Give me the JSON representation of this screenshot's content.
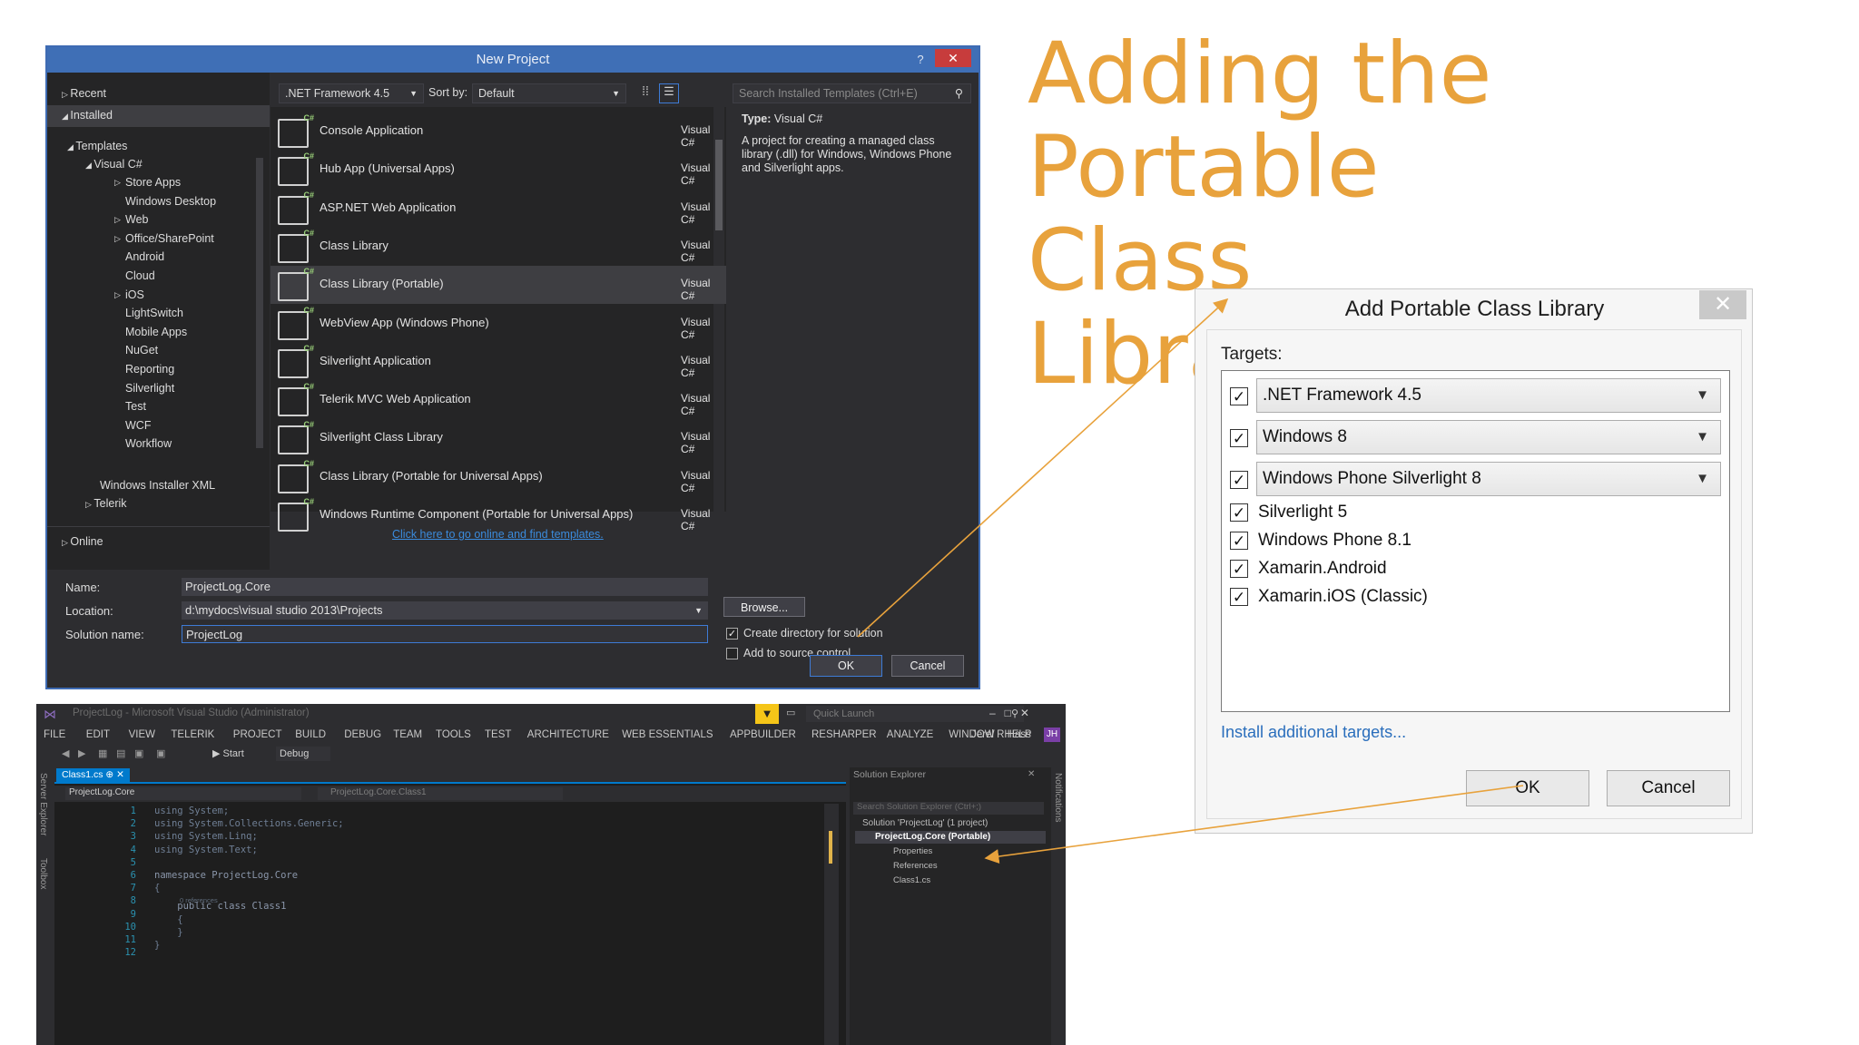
{
  "slide": {
    "title_lines": [
      "Adding the",
      "Portable Class",
      "Library"
    ]
  },
  "new_project": {
    "title": "New Project",
    "help": "?",
    "close": "✕",
    "tree": {
      "recent": "Recent",
      "installed": "Installed",
      "templates": "Templates",
      "visual_csharp": "Visual C#",
      "children": [
        "Store Apps",
        "Windows Desktop",
        "Web",
        "Office/SharePoint",
        "Android",
        "Cloud",
        "iOS",
        "LightSwitch",
        "Mobile Apps",
        "NuGet",
        "Reporting",
        "Silverlight",
        "Test",
        "WCF",
        "Workflow"
      ],
      "windows_installer_xml": "Windows Installer XML",
      "telerik": "Telerik",
      "online": "Online"
    },
    "framework": ".NET Framework 4.5",
    "sort_by_label": "Sort by:",
    "sort_by_value": "Default",
    "search_placeholder": "Search Installed Templates (Ctrl+E)",
    "templates": [
      {
        "name": "Console Application",
        "lang": "Visual C#"
      },
      {
        "name": "Hub App (Universal Apps)",
        "lang": "Visual C#"
      },
      {
        "name": "ASP.NET Web Application",
        "lang": "Visual C#"
      },
      {
        "name": "Class Library",
        "lang": "Visual C#"
      },
      {
        "name": "Class Library (Portable)",
        "lang": "Visual C#"
      },
      {
        "name": "WebView App (Windows Phone)",
        "lang": "Visual C#"
      },
      {
        "name": "Silverlight Application",
        "lang": "Visual C#"
      },
      {
        "name": "Telerik MVC Web Application",
        "lang": "Visual C#"
      },
      {
        "name": "Silverlight Class Library",
        "lang": "Visual C#"
      },
      {
        "name": "Class Library (Portable for Universal Apps)",
        "lang": "Visual C#"
      },
      {
        "name": "Windows Runtime Component (Portable for Universal Apps)",
        "lang": "Visual C#"
      }
    ],
    "online_link": "Click here to go online and find templates.",
    "description": {
      "type_label": "Type:",
      "type_value": "Visual C#",
      "text": "A project for creating a managed class library (.dll) for Windows, Windows Phone and Silverlight apps."
    },
    "name_label": "Name:",
    "name_value": "ProjectLog.Core",
    "location_label": "Location:",
    "location_value": "d:\\mydocs\\visual studio 2013\\Projects",
    "solution_label": "Solution name:",
    "solution_value": "ProjectLog",
    "browse": "Browse...",
    "create_dir": "Create directory for solution",
    "add_source": "Add to source control",
    "ok": "OK",
    "cancel": "Cancel"
  },
  "ide": {
    "title": "ProjectLog - Microsoft Visual Studio (Administrator)",
    "quick_launch": "Quick Launch",
    "menus": [
      "FILE",
      "EDIT",
      "VIEW",
      "TELERIK",
      "PROJECT",
      "BUILD",
      "DEBUG",
      "TEAM",
      "TOOLS",
      "TEST",
      "ARCHITECTURE",
      "WEB ESSENTIALS",
      "APPBUILDER",
      "RESHARPER",
      "ANALYZE",
      "WINDOW",
      "HELP"
    ],
    "user": "Jerel R Hass",
    "user_initials": "JH",
    "start": "Start",
    "config": "Debug",
    "side_tabs": [
      "Server Explorer",
      "Toolbox"
    ],
    "right_tab": "Notifications",
    "doc_tab": "Class1.cs",
    "nav_left": "ProjectLog.Core",
    "nav_right": "ProjectLog.Core.Class1",
    "line_numbers": [
      "1",
      "2",
      "3",
      "4",
      "5",
      "6",
      "7",
      "8",
      "9",
      "10",
      "11",
      "12"
    ],
    "code_lines": [
      "using System;",
      "using System.Collections.Generic;",
      "using System.Linq;",
      "using System.Text;",
      "",
      "namespace ProjectLog.Core",
      "{",
      "    public class Class1",
      "    {",
      "    }",
      "}",
      ""
    ],
    "code_lens": "0 references",
    "solution_explorer": {
      "title": "Solution Explorer",
      "search": "Search Solution Explorer (Ctrl+;)",
      "items": [
        "Solution 'ProjectLog' (1 project)",
        "ProjectLog.Core (Portable)",
        "Properties",
        "References",
        "Class1.cs"
      ]
    }
  },
  "add_pcl": {
    "title": "Add Portable Class Library",
    "close": "✕",
    "targets_label": "Targets:",
    "combo_targets": [
      ".NET Framework 4.5",
      "Windows 8",
      "Windows Phone Silverlight 8"
    ],
    "check_targets": [
      "Silverlight 5",
      "Windows Phone 8.1",
      "Xamarin.Android",
      "Xamarin.iOS (Classic)"
    ],
    "check_mark": "✓",
    "install_link": "Install additional targets...",
    "ok": "OK",
    "cancel": "Cancel"
  },
  "colors": {
    "accent_orange": "#e8a23c",
    "vs_blue": "#3f6fb6",
    "vs_dark": "#2d2d30"
  }
}
